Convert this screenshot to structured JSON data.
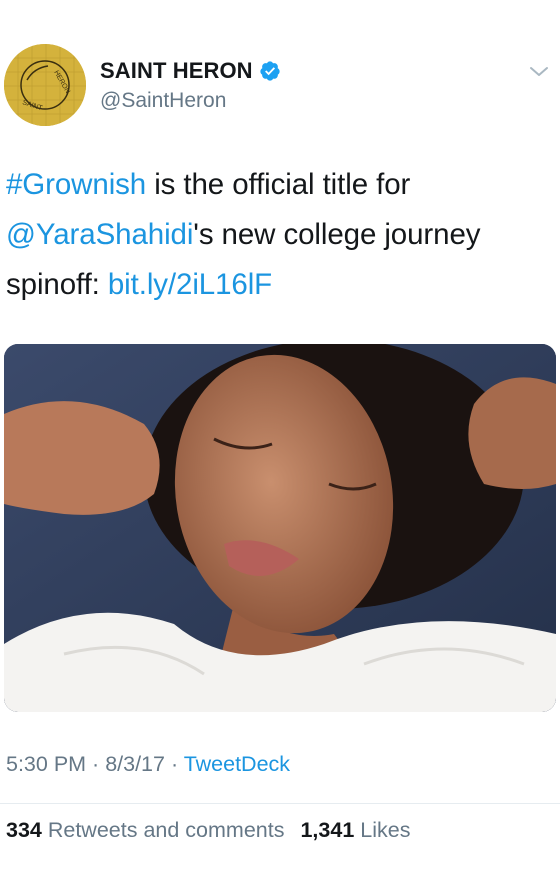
{
  "account": {
    "display_name": "SAINT HERON",
    "handle": "@SaintHeron",
    "verified": true,
    "avatar_text": "SAINT HERON",
    "avatar_color": "#d4b23c"
  },
  "tweet": {
    "hashtag": "#Grownish",
    "text_1": " is the official title for",
    "mention": "@YaraShahidi",
    "text_2": "'s new college journey spinoff: ",
    "link": "bit.ly/2iL16lF"
  },
  "media": {
    "description_icon": "portrait-photo"
  },
  "meta": {
    "time": "5:30 PM",
    "separator_1": " · ",
    "date": "8/3/17",
    "separator_2": " · ",
    "source": "TweetDeck"
  },
  "stats": {
    "retweets_count": "334",
    "retweets_label": " Retweets and comments",
    "likes_count": "1,341",
    "likes_label": " Likes"
  },
  "colors": {
    "link": "#1b95e0",
    "secondary_text": "#657786",
    "primary_text": "#14171a",
    "verified_badge": "#1da1f2"
  }
}
